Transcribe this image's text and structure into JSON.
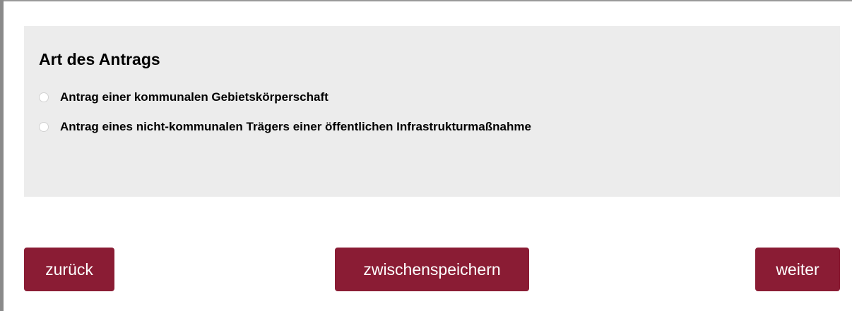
{
  "section": {
    "title": "Art des Antrags",
    "options": [
      {
        "label": "Antrag einer kommunalen Gebietskörperschaft",
        "selected": false
      },
      {
        "label": "Antrag eines nicht-kommunalen Trägers einer öffentlichen Infrastrukturmaßnahme",
        "selected": false
      }
    ]
  },
  "navigation": {
    "back_label": "zurück",
    "save_label": "zwischenspeichern",
    "next_label": "weiter"
  },
  "colors": {
    "button_background": "#8a1c34",
    "panel_background": "#ececec"
  }
}
